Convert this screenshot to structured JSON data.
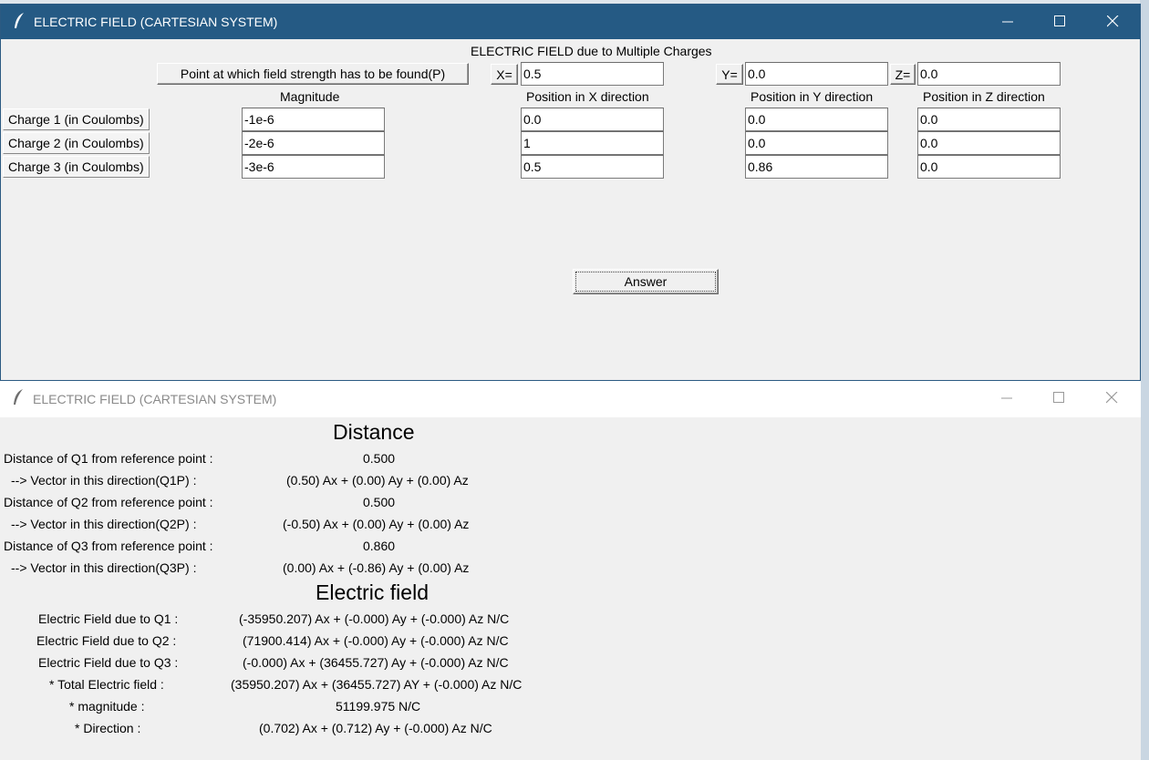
{
  "window1": {
    "title": "ELECTRIC FIELD (CARTESIAN SYSTEM)",
    "heading": "ELECTRIC FIELD due to Multiple Charges",
    "point_button": "Point at which field strength has to be found(P)",
    "x_label": "X=",
    "y_label": "Y=",
    "z_label": "Z=",
    "point": {
      "x": "0.5",
      "y": "0.0",
      "z": "0.0"
    },
    "col_headers": {
      "magnitude": "Magnitude",
      "pos_x": "Position in X direction",
      "pos_y": "Position in Y direction",
      "pos_z": "Position in Z direction"
    },
    "charges": [
      {
        "label": "Charge 1 (in Coulombs)",
        "magnitude": "-1e-6",
        "x": "0.0",
        "y": "0.0",
        "z": "0.0"
      },
      {
        "label": "Charge 2 (in Coulombs)",
        "magnitude": "-2e-6",
        "x": "1",
        "y": "0.0",
        "z": "0.0"
      },
      {
        "label": "Charge 3 (in Coulombs)",
        "magnitude": "-3e-6",
        "x": "0.5",
        "y": "0.86",
        "z": "0.0"
      }
    ],
    "answer_button": "Answer"
  },
  "window2": {
    "title": "ELECTRIC FIELD (CARTESIAN SYSTEM)",
    "distance_heading": "Distance",
    "distance_rows": [
      {
        "label": "Distance of Q1 from reference point :",
        "value": "0.500"
      },
      {
        "label": "--> Vector in this direction(Q1P)   :",
        "value": "(0.50) Ax + (0.00) Ay + (0.00) Az"
      },
      {
        "label": "Distance of Q2 from reference point :",
        "value": "0.500"
      },
      {
        "label": "--> Vector in this direction(Q2P)   :",
        "value": "(-0.50) Ax + (0.00) Ay + (0.00) Az"
      },
      {
        "label": "Distance of Q3 from reference point :",
        "value": "0.860"
      },
      {
        "label": "--> Vector in this direction(Q3P)   :",
        "value": "(0.00) Ax + (-0.86) Ay + (0.00) Az"
      }
    ],
    "field_heading": "Electric field",
    "field_rows": [
      {
        "label": "Electric Field due to Q1   :",
        "value": "(-35950.207) Ax + (-0.000) Ay + (-0.000) Az N/C"
      },
      {
        "label": "Electric Field  due to Q2   :",
        "value": "(71900.414) Ax + (-0.000) Ay + (-0.000) Az N/C"
      },
      {
        "label": "Electric Field due to Q3   :",
        "value": "(-0.000) Ax + (36455.727) Ay + (-0.000) Az N/C"
      },
      {
        "label": "* Total Electric field    :",
        "value": "(35950.207) Ax + (36455.727) AY + (-0.000) Az N/C"
      },
      {
        "label": "* magnitude   :",
        "value": "51199.975 N/C"
      },
      {
        "label": "* Direction   :",
        "value": "(0.702) Ax + (0.712) Ay + (-0.000) Az N/C"
      }
    ]
  }
}
